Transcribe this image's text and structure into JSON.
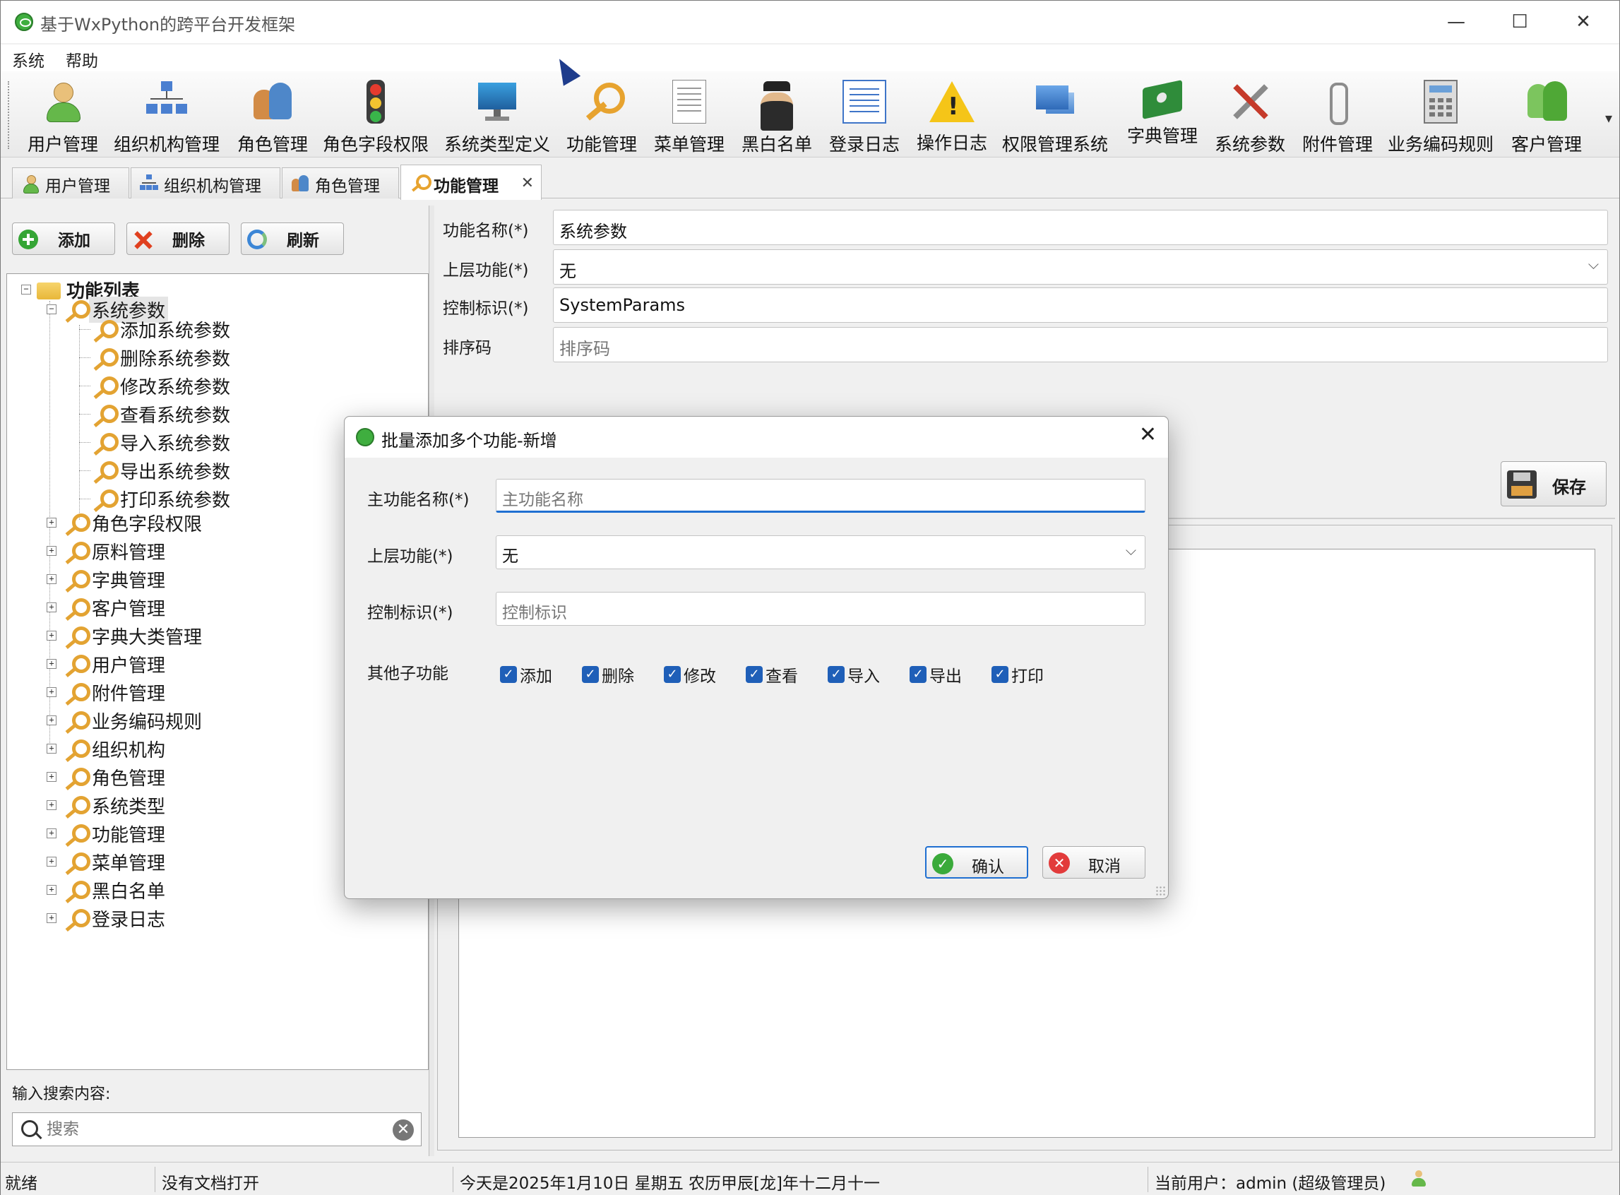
{
  "window": {
    "title": "基于WxPython的跨平台开发框架",
    "minimize": "—",
    "maximize": "☐",
    "close": "✕"
  },
  "menu": [
    "系统",
    "帮助"
  ],
  "toolbar": {
    "items": [
      {
        "label": "用户管理",
        "icon": "user-icon"
      },
      {
        "label": "组织机构管理",
        "icon": "org-chart-icon"
      },
      {
        "label": "角色管理",
        "icon": "role-icon"
      },
      {
        "label": "角色字段权限",
        "icon": "traffic-light-icon"
      },
      {
        "label": "系统类型定义",
        "icon": "monitor-icon"
      },
      {
        "label": "功能管理",
        "icon": "key-icon"
      },
      {
        "label": "菜单管理",
        "icon": "document-icon"
      },
      {
        "label": "黑白名单",
        "icon": "spy-icon"
      },
      {
        "label": "登录日志",
        "icon": "log-icon"
      },
      {
        "label": "操作日志",
        "icon": "warning-icon"
      },
      {
        "label": "权限管理系统",
        "icon": "permission-icon"
      },
      {
        "label": "字典管理",
        "icon": "book-icon"
      },
      {
        "label": "系统参数",
        "icon": "tools-icon"
      },
      {
        "label": "附件管理",
        "icon": "paperclip-icon"
      },
      {
        "label": "业务编码规则",
        "icon": "calculator-icon"
      },
      {
        "label": "客户管理",
        "icon": "group-icon"
      }
    ],
    "more": "▾"
  },
  "tabs": [
    {
      "label": "用户管理",
      "icon": "user-icon",
      "active": false
    },
    {
      "label": "组织机构管理",
      "icon": "org-chart-icon",
      "active": false
    },
    {
      "label": "角色管理",
      "icon": "role-icon",
      "active": false
    },
    {
      "label": "功能管理",
      "icon": "key-icon",
      "active": true,
      "close": "✕"
    }
  ],
  "left": {
    "buttons": {
      "add": "添加",
      "delete": "删除",
      "refresh": "刷新"
    },
    "tree": {
      "root": "功能列表",
      "expanded": "系统参数",
      "children": [
        "添加系统参数",
        "删除系统参数",
        "修改系统参数",
        "查看系统参数",
        "导入系统参数",
        "导出系统参数",
        "打印系统参数"
      ],
      "others": [
        "角色字段权限",
        "原料管理",
        "字典管理",
        "客户管理",
        "字典大类管理",
        "用户管理",
        "附件管理",
        "业务编码规则",
        "组织机构",
        "角色管理",
        "系统类型",
        "功能管理",
        "菜单管理",
        "黑白名单",
        "登录日志"
      ],
      "expand_minus": "−",
      "expand_plus": "+"
    },
    "search": {
      "label": "输入搜索内容:",
      "placeholder": "搜索",
      "clear": "✕"
    }
  },
  "form": {
    "name_label": "功能名称(*)",
    "name_value": "系统参数",
    "parent_label": "上层功能(*)",
    "parent_value": "无",
    "control_label": "控制标识(*)",
    "control_value": "SystemParams",
    "sort_label": "排序码",
    "sort_placeholder": "排序码",
    "save": "保存",
    "dropdown": "⌵"
  },
  "dialog": {
    "title": "批量添加多个功能-新增",
    "close": "✕",
    "main_label": "主功能名称(*)",
    "main_placeholder": "主功能名称",
    "parent_label": "上层功能(*)",
    "parent_value": "无",
    "control_label": "控制标识(*)",
    "control_placeholder": "控制标识",
    "sub_label": "其他子功能",
    "checkboxes": [
      {
        "label": "添加",
        "checked": true
      },
      {
        "label": "删除",
        "checked": true
      },
      {
        "label": "修改",
        "checked": true
      },
      {
        "label": "查看",
        "checked": true
      },
      {
        "label": "导入",
        "checked": true
      },
      {
        "label": "导出",
        "checked": true
      },
      {
        "label": "打印",
        "checked": true
      }
    ],
    "check_mark": "✓",
    "ok": "确认",
    "ok_mark": "✓",
    "cancel": "取消",
    "cancel_mark": "✕"
  },
  "status": {
    "ready": "就绪",
    "doc": "没有文档打开",
    "date": "今天是2025年1月10日 星期五 农历甲辰[龙]年十二月十一",
    "user": "当前用户：admin (超级管理员)"
  },
  "colors": {
    "accent": "#1f6fd1",
    "app_green": "#3fae3f"
  }
}
